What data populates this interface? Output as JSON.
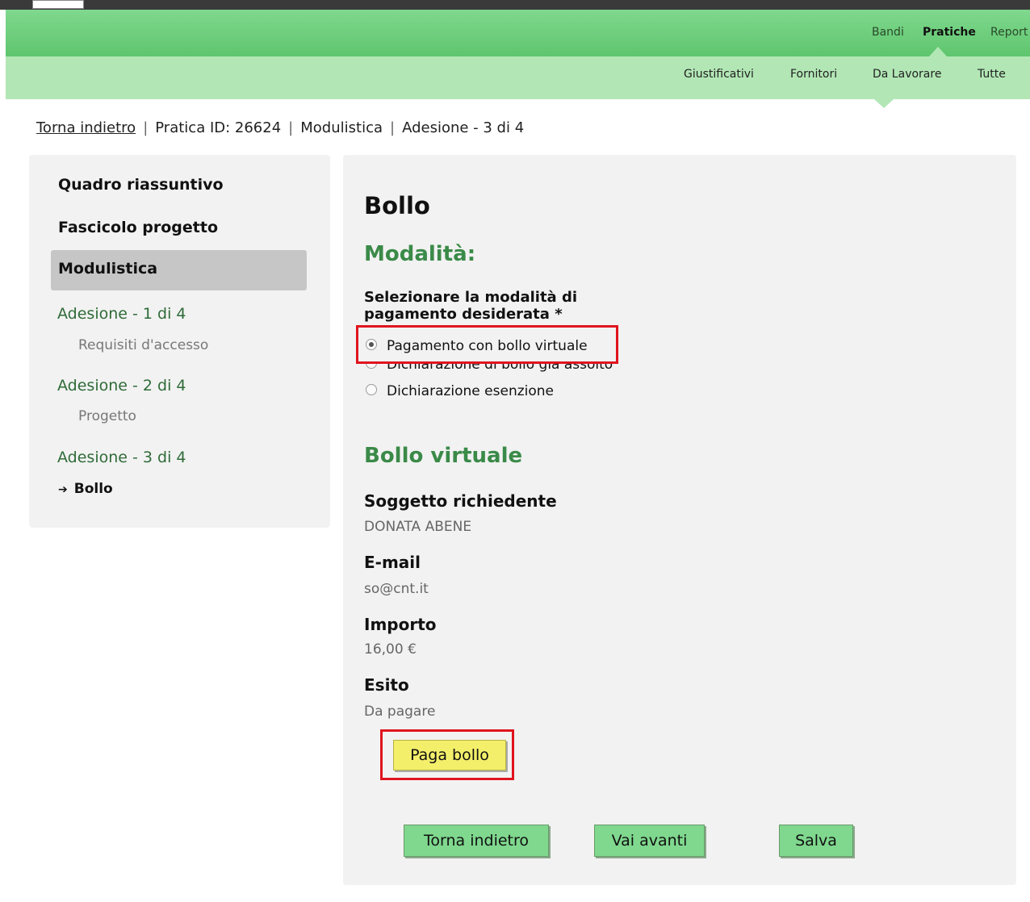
{
  "nav": {
    "main": [
      "Bandi",
      "Pratiche",
      "Report"
    ],
    "main_active": "Pratiche",
    "sub": [
      "Giustificativi",
      "Fornitori",
      "Da Lavorare",
      "Tutte"
    ]
  },
  "breadcrumb": {
    "back": "Torna indietro",
    "sep": "|",
    "practice": "Pratica ID: 26624",
    "section": "Modulistica",
    "step": "Adesione - 3 di 4"
  },
  "sidebar": {
    "summary": "Quadro riassuntivo",
    "project_file": "Fascicolo progetto",
    "forms": "Modulistica",
    "steps": [
      {
        "label": "Adesione - 1 di 4",
        "sub": "Requisiti d'accesso"
      },
      {
        "label": "Adesione - 2 di 4",
        "sub": "Progetto"
      },
      {
        "label": "Adesione - 3 di 4",
        "sub": "Bollo"
      }
    ],
    "current_arrow": "➔"
  },
  "main": {
    "title": "Bollo",
    "modalita_heading": "Modalità:",
    "question": "Selezionare la modalità di pagamento desiderata *",
    "options": [
      {
        "label": "Pagamento con bollo virtuale",
        "checked": true
      },
      {
        "label": "Dichiarazione di bollo già assolto",
        "checked": false
      },
      {
        "label": "Dichiarazione esenzione",
        "checked": false
      }
    ],
    "virtual_heading": "Bollo virtuale",
    "fields": [
      {
        "label": "Soggetto richiedente",
        "value": "DONATA ABENE"
      },
      {
        "label": "E-mail",
        "value": "so@cnt.it"
      },
      {
        "label": "Importo",
        "value": "16,00 €"
      },
      {
        "label": "Esito",
        "value": "Da pagare"
      }
    ],
    "pay_button": "Paga bollo",
    "back_button": "Torna indietro",
    "next_button": "Vai avanti",
    "save_button": "Salva"
  },
  "colors": {
    "nav_green": "#5fc56e",
    "subnav_green": "#b2e7b5",
    "heading_green": "#3a8a48",
    "highlight_red": "#e0141e",
    "pay_yellow": "#f4ef6a"
  }
}
